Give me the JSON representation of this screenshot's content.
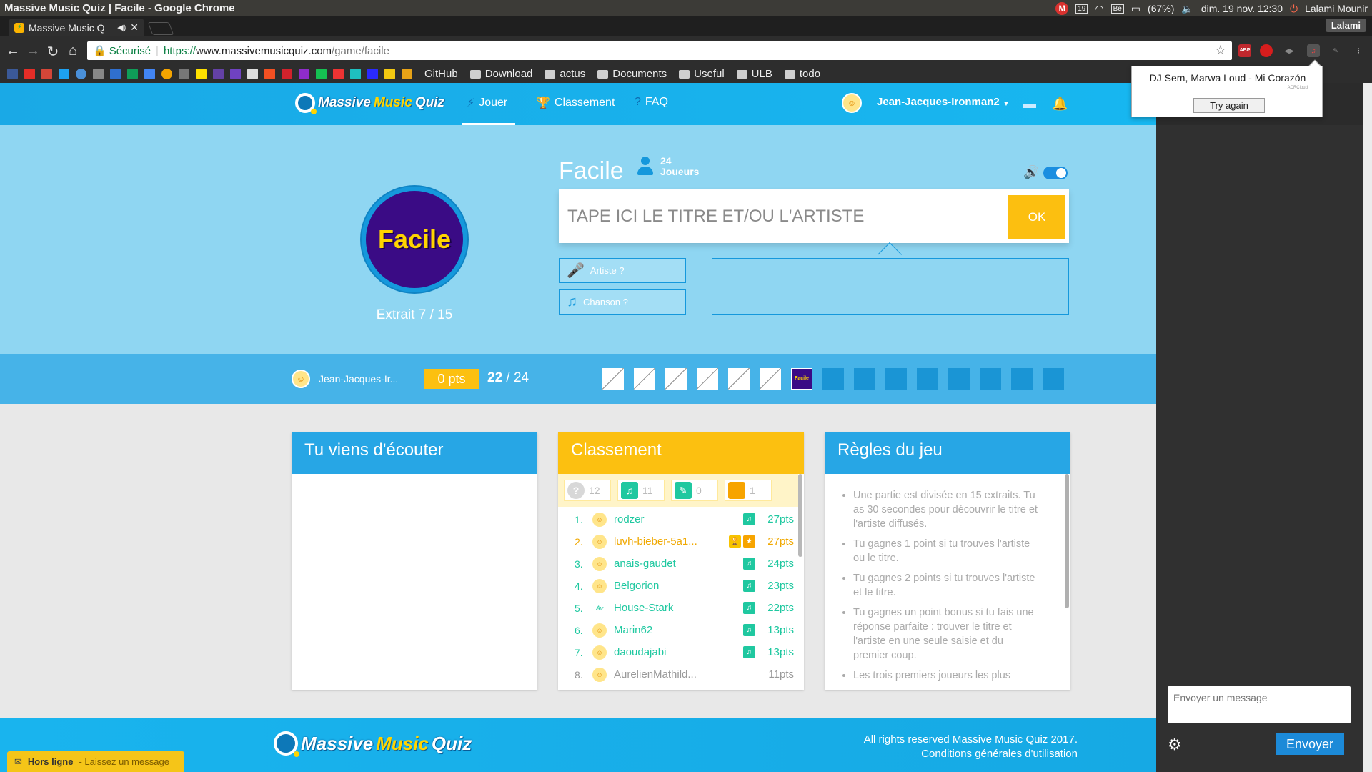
{
  "os": {
    "window_title": "Massive Music Quiz | Facile - Google Chrome",
    "battery": "(67%)",
    "datetime": "dim. 19 nov. 12:30",
    "user": "Lalami Mounir",
    "calendar_day": "19",
    "keyboard": "Be",
    "mail_badge": "M"
  },
  "browser": {
    "tab_title": "Massive Music Q",
    "profile": "Lalami",
    "secure_label": "Sécurisé",
    "url_scheme": "https://",
    "url_host": "www.massivemusicquiz.com",
    "url_path": "/game/facile",
    "bookmarks": [
      {
        "label": "GitHub",
        "folder": false
      },
      {
        "label": "Download",
        "folder": true
      },
      {
        "label": "actus",
        "folder": true
      },
      {
        "label": "Documents",
        "folder": true
      },
      {
        "label": "Useful",
        "folder": true
      },
      {
        "label": "ULB",
        "folder": true
      },
      {
        "label": "todo",
        "folder": true
      }
    ],
    "ext_abp": "ABP"
  },
  "popup": {
    "song": "DJ Sem, Marwa Loud - Mi Corazón",
    "brand": "ACRCloud",
    "retry": "Try again"
  },
  "header": {
    "logo_part1": "Massive",
    "logo_part2": "Music",
    "logo_part3": "Quiz",
    "nav": [
      "Jouer",
      "Classement",
      "FAQ"
    ],
    "username": "Jean-Jacques-Ironman2"
  },
  "game": {
    "level_badge": "Facile",
    "extract": "Extrait 7 / 15",
    "title": "Facile",
    "players_count": "24",
    "players_label": "Joueurs",
    "answer_placeholder": "TAPE ICI LE TITRE ET/OU L'ARTISTE",
    "ok_label": "OK",
    "hint_artist": "Artiste ?",
    "hint_song": "Chanson ?"
  },
  "progress": {
    "username": "Jean-Jacques-Ir...",
    "points": "0 pts",
    "players_done": "22",
    "players_total": "/ 24",
    "current_badge": "Facile",
    "current_extract": 7,
    "total_extracts": 15
  },
  "panels": {
    "listened_title": "Tu viens d'écouter",
    "ranking_title": "Classement",
    "rules_title": "Règles du jeu",
    "stats": [
      {
        "icon": "question-icon",
        "value": "12",
        "color": "#d8d8d8"
      },
      {
        "icon": "music-icon",
        "value": "11",
        "color": "#1fc8a0"
      },
      {
        "icon": "mic-icon",
        "value": "0",
        "color": "#1fc8a0"
      },
      {
        "icon": "star-icon",
        "value": "1",
        "color": "#f7a400"
      }
    ],
    "ranking": [
      {
        "rank": "1.",
        "name": "rodzer",
        "points": "27pts",
        "style": "normal",
        "icons": [
          "music"
        ]
      },
      {
        "rank": "2.",
        "name": "luvh-bieber-5a1...",
        "points": "27pts",
        "style": "gold",
        "icons": [
          "trophy",
          "star"
        ]
      },
      {
        "rank": "3.",
        "name": "anais-gaudet",
        "points": "24pts",
        "style": "normal",
        "icons": [
          "music"
        ]
      },
      {
        "rank": "4.",
        "name": "Belgorion",
        "points": "23pts",
        "style": "normal",
        "icons": [
          "music"
        ]
      },
      {
        "rank": "5.",
        "name": "House-Stark",
        "points": "22pts",
        "style": "normal",
        "icons": [
          "music"
        ],
        "avatar_text": "Av"
      },
      {
        "rank": "6.",
        "name": "Marin62",
        "points": "13pts",
        "style": "normal",
        "icons": [
          "music"
        ]
      },
      {
        "rank": "7.",
        "name": "daoudajabi",
        "points": "13pts",
        "style": "normal",
        "icons": [
          "music"
        ]
      },
      {
        "rank": "8.",
        "name": "AurelienMathild...",
        "points": "11pts",
        "style": "grey",
        "icons": []
      }
    ],
    "rules": [
      "Une partie est divisée en 15 extraits. Tu as 30 secondes pour découvrir le titre et l'artiste diffusés.",
      "Tu gagnes 1 point si tu trouves l'artiste ou le titre.",
      "Tu gagnes 2 points si tu trouves l'artiste et le titre.",
      "Tu gagnes un point bonus si tu fais une réponse parfaite : trouver le titre et l'artiste en une seule saisie et du premier coup.",
      "Les trois premiers joueurs les plus rapides à trouver l'artiste et le titre"
    ]
  },
  "footer": {
    "rights": "All rights reserved Massive Music Quiz 2017.",
    "terms": "Conditions générales d'utilisation"
  },
  "offline": {
    "status": "Hors ligne",
    "action": "- Laissez un message"
  },
  "chat": {
    "placeholder": "Envoyer un message",
    "send": "Envoyer"
  }
}
